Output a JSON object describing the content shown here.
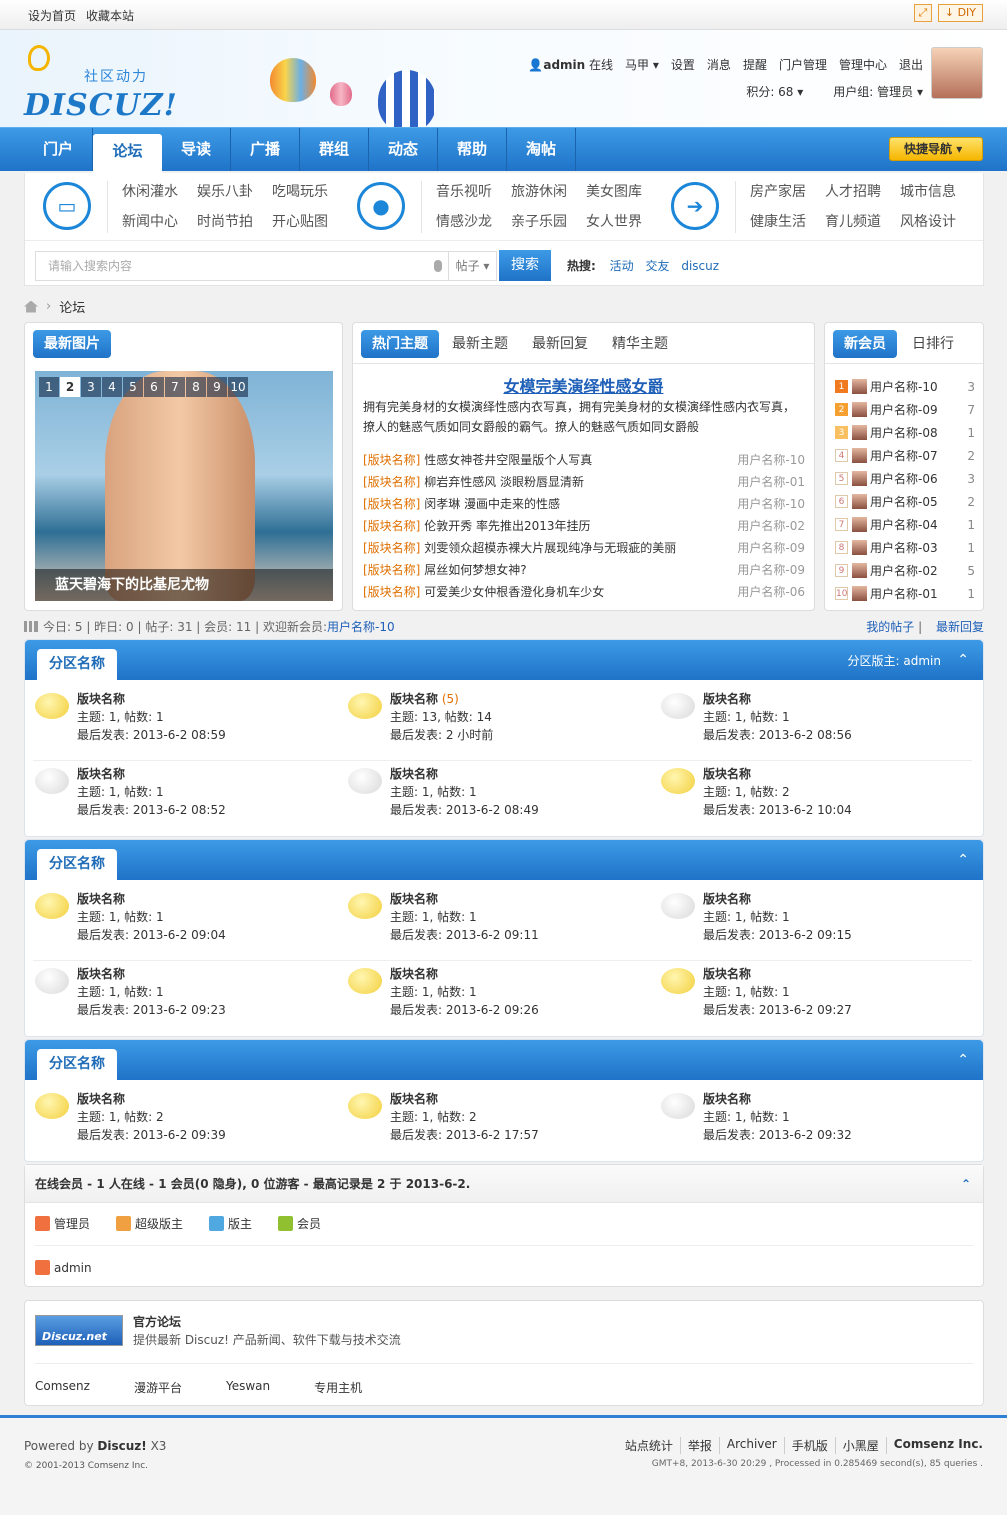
{
  "topbar": {
    "set_home": "设为首页",
    "bookmark": "收藏本站",
    "diy": "DIY"
  },
  "header": {
    "logo_cn": "社区动力",
    "logo_en": "DISCUZ!",
    "user": "admin",
    "status": "在线",
    "links": [
      "马甲",
      "设置",
      "消息",
      "提醒",
      "门户管理",
      "管理中心",
      "退出"
    ],
    "points": "积分: 68",
    "group": "用户组: 管理员"
  },
  "nav": {
    "items": [
      "门户",
      "论坛",
      "导读",
      "广播",
      "群组",
      "动态",
      "帮助",
      "淘帖"
    ],
    "active": "论坛",
    "quick": "快捷导航"
  },
  "categories": {
    "g1": [
      "休闲灌水",
      "娱乐八卦",
      "吃喝玩乐",
      "新闻中心",
      "时尚节拍",
      "开心贴图"
    ],
    "g2": [
      "音乐视听",
      "旅游休闲",
      "美女图库",
      "情感沙龙",
      "亲子乐园",
      "女人世界"
    ],
    "g3": [
      "房产家居",
      "人才招聘",
      "城市信息",
      "健康生活",
      "育儿频道",
      "风格设计"
    ]
  },
  "search": {
    "placeholder": "请输入搜索内容",
    "type": "帖子",
    "button": "搜索",
    "hot_label": "热搜:",
    "hot": [
      "活动",
      "交友",
      "discuz"
    ]
  },
  "breadcrumb": {
    "current": "论坛"
  },
  "latest_pics": {
    "title": "最新图片",
    "pages": [
      "1",
      "2",
      "3",
      "4",
      "5",
      "6",
      "7",
      "8",
      "9",
      "10"
    ],
    "active_page": "2",
    "caption": "蓝天碧海下的比基尼尤物"
  },
  "topics": {
    "tabs": [
      "热门主题",
      "最新主题",
      "最新回复",
      "精华主题"
    ],
    "headline": "女模完美演绎性感女爵",
    "desc": "拥有完美身材的女模演绎性感内衣写真，拥有完美身材的女模演绎性感内衣写真，撩人的魅惑气质如同女爵般的霸气。撩人的魅惑气质如同女爵般",
    "rows": [
      {
        "tag": "[版块名称]",
        "title": "性感女神苍井空限量版个人写真",
        "user": "用户名称-10"
      },
      {
        "tag": "[版块名称]",
        "title": "柳岩弃性感风 淡眼粉唇显清新",
        "user": "用户名称-01"
      },
      {
        "tag": "[版块名称]",
        "title": "闵孝琳 漫画中走来的性感",
        "user": "用户名称-10"
      },
      {
        "tag": "[版块名称]",
        "title": "伦敦开秀 率先推出2013年挂历",
        "user": "用户名称-02"
      },
      {
        "tag": "[版块名称]",
        "title": "刘雯领众超模赤裸大片展现纯净与无瑕疵的美丽",
        "user": "用户名称-09"
      },
      {
        "tag": "[版块名称]",
        "title": "屌丝如何梦想女神?",
        "user": "用户名称-09"
      },
      {
        "tag": "[版块名称]",
        "title": "可爱美少女仲根香澄化身机车少女",
        "user": "用户名称-06"
      }
    ]
  },
  "members": {
    "tabs": [
      "新会员",
      "日排行"
    ],
    "rows": [
      {
        "rank": "1",
        "name": "用户名称-10",
        "num": "3"
      },
      {
        "rank": "2",
        "name": "用户名称-09",
        "num": "7"
      },
      {
        "rank": "3",
        "name": "用户名称-08",
        "num": "1"
      },
      {
        "rank": "4",
        "name": "用户名称-07",
        "num": "2"
      },
      {
        "rank": "5",
        "name": "用户名称-06",
        "num": "3"
      },
      {
        "rank": "6",
        "name": "用户名称-05",
        "num": "2"
      },
      {
        "rank": "7",
        "name": "用户名称-04",
        "num": "1"
      },
      {
        "rank": "8",
        "name": "用户名称-03",
        "num": "1"
      },
      {
        "rank": "9",
        "name": "用户名称-02",
        "num": "5"
      },
      {
        "rank": "10",
        "name": "用户名称-01",
        "num": "1"
      }
    ]
  },
  "stats": {
    "today": "今日: 5",
    "yesterday": "昨日: 0",
    "posts": "帖子: 31",
    "members": "会员: 11",
    "welcome": "欢迎新会员:",
    "new_member": "用户名称-10",
    "my_posts": "我的帖子",
    "latest_reply": "最新回复"
  },
  "sections": [
    {
      "name": "分区名称",
      "moderator": "分区版主: admin",
      "forums": [
        {
          "name": "版块名称",
          "today": "",
          "stats": "主题: 1, 帖数: 1",
          "last": "最后发表: 2013-6-2 08:59",
          "new": true
        },
        {
          "name": "版块名称",
          "today": "(5)",
          "stats": "主题: 13, 帖数: 14",
          "last": "最后发表: 2 小时前",
          "new": true
        },
        {
          "name": "版块名称",
          "today": "",
          "stats": "主题: 1, 帖数: 1",
          "last": "最后发表: 2013-6-2 08:56",
          "new": false
        },
        {
          "name": "版块名称",
          "today": "",
          "stats": "主题: 1, 帖数: 1",
          "last": "最后发表: 2013-6-2 08:52",
          "new": false
        },
        {
          "name": "版块名称",
          "today": "",
          "stats": "主题: 1, 帖数: 1",
          "last": "最后发表: 2013-6-2 08:49",
          "new": false
        },
        {
          "name": "版块名称",
          "today": "",
          "stats": "主题: 1, 帖数: 2",
          "last": "最后发表: 2013-6-2 10:04",
          "new": true
        }
      ]
    },
    {
      "name": "分区名称",
      "moderator": "",
      "forums": [
        {
          "name": "版块名称",
          "today": "",
          "stats": "主题: 1, 帖数: 1",
          "last": "最后发表: 2013-6-2 09:04",
          "new": true
        },
        {
          "name": "版块名称",
          "today": "",
          "stats": "主题: 1, 帖数: 1",
          "last": "最后发表: 2013-6-2 09:11",
          "new": true
        },
        {
          "name": "版块名称",
          "today": "",
          "stats": "主题: 1, 帖数: 1",
          "last": "最后发表: 2013-6-2 09:15",
          "new": false
        },
        {
          "name": "版块名称",
          "today": "",
          "stats": "主题: 1, 帖数: 1",
          "last": "最后发表: 2013-6-2 09:23",
          "new": false
        },
        {
          "name": "版块名称",
          "today": "",
          "stats": "主题: 1, 帖数: 1",
          "last": "最后发表: 2013-6-2 09:26",
          "new": true
        },
        {
          "name": "版块名称",
          "today": "",
          "stats": "主题: 1, 帖数: 1",
          "last": "最后发表: 2013-6-2 09:27",
          "new": true
        }
      ]
    },
    {
      "name": "分区名称",
      "moderator": "",
      "forums": [
        {
          "name": "版块名称",
          "today": "",
          "stats": "主题: 1, 帖数: 2",
          "last": "最后发表: 2013-6-2 09:39",
          "new": true
        },
        {
          "name": "版块名称",
          "today": "",
          "stats": "主题: 1, 帖数: 2",
          "last": "最后发表: 2013-6-2 17:57",
          "new": true
        },
        {
          "name": "版块名称",
          "today": "",
          "stats": "主题: 1, 帖数: 1",
          "last": "最后发表: 2013-6-2 09:32",
          "new": false
        }
      ]
    }
  ],
  "online": {
    "title": "在线会员 - 1 人在线 - 1 会员(0 隐身), 0 位游客 - 最高记录是 2 于 2013-6-2.",
    "legend": [
      "管理员",
      "超级版主",
      "版主",
      "会员"
    ],
    "user": "admin"
  },
  "links": {
    "name": "官方论坛",
    "desc": "提供最新 Discuz! 产品新闻、软件下载与技术交流",
    "logo_text": "Discuz.net",
    "items": [
      "Comsenz",
      "漫游平台",
      "Yeswan",
      "专用主机"
    ]
  },
  "footer": {
    "powered": "Powered by",
    "brand": "Discuz!",
    "version": "X3",
    "copyright": "© 2001-2013 Comsenz Inc.",
    "nav": [
      "站点统计",
      "举报",
      "Archiver",
      "手机版",
      "小黑屋"
    ],
    "company": "Comsenz Inc.",
    "gmt": "GMT+8, 2013-6-30 20:29 , Processed in 0.285469 second(s), 85 queries ."
  }
}
